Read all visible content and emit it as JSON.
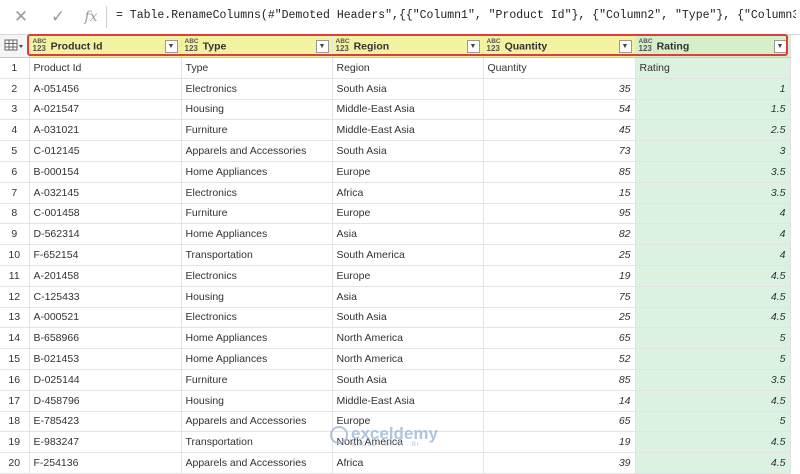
{
  "formula_bar": {
    "cancel_icon": "close-icon",
    "confirm_icon": "check-icon",
    "fx_label": "fx",
    "formula": "= Table.RenameColumns(#\"Demoted Headers\",{{\"Column1\", \"Product Id\"}, {\"Column2\", \"Type\"}, {\"Column3\","
  },
  "type_icon": {
    "top": "ABC",
    "bottom": "123"
  },
  "headers": [
    "Product Id",
    "Type",
    "Region",
    "Quantity",
    "Rating"
  ],
  "rows": [
    {
      "n": "1",
      "id": "Product Id",
      "type": "Type",
      "region": "Region",
      "qty": "Quantity",
      "rating": "Rating"
    },
    {
      "n": "2",
      "id": "A-051456",
      "type": "Electronics",
      "region": "South Asia",
      "qty": "35",
      "rating": "1"
    },
    {
      "n": "3",
      "id": "A-021547",
      "type": "Housing",
      "region": "Middle-East Asia",
      "qty": "54",
      "rating": "1.5"
    },
    {
      "n": "4",
      "id": "A-031021",
      "type": "Furniture",
      "region": "Middle-East Asia",
      "qty": "45",
      "rating": "2.5"
    },
    {
      "n": "5",
      "id": "C-012145",
      "type": "Apparels and Accessories",
      "region": "South Asia",
      "qty": "73",
      "rating": "3"
    },
    {
      "n": "6",
      "id": "B-000154",
      "type": "Home Appliances",
      "region": "Europe",
      "qty": "85",
      "rating": "3.5"
    },
    {
      "n": "7",
      "id": "A-032145",
      "type": "Electronics",
      "region": "Africa",
      "qty": "15",
      "rating": "3.5"
    },
    {
      "n": "8",
      "id": "C-001458",
      "type": "Furniture",
      "region": "Europe",
      "qty": "95",
      "rating": "4"
    },
    {
      "n": "9",
      "id": "D-562314",
      "type": "Home Appliances",
      "region": "Asia",
      "qty": "82",
      "rating": "4"
    },
    {
      "n": "10",
      "id": "F-652154",
      "type": "Transportation",
      "region": "South America",
      "qty": "25",
      "rating": "4"
    },
    {
      "n": "11",
      "id": "A-201458",
      "type": "Electronics",
      "region": "Europe",
      "qty": "19",
      "rating": "4.5"
    },
    {
      "n": "12",
      "id": "C-125433",
      "type": "Housing",
      "region": "Asia",
      "qty": "75",
      "rating": "4.5"
    },
    {
      "n": "13",
      "id": "A-000521",
      "type": "Electronics",
      "region": "South Asia",
      "qty": "25",
      "rating": "4.5"
    },
    {
      "n": "14",
      "id": "B-658966",
      "type": "Home Appliances",
      "region": "North America",
      "qty": "65",
      "rating": "5"
    },
    {
      "n": "15",
      "id": "B-021453",
      "type": "Home Appliances",
      "region": "North America",
      "qty": "52",
      "rating": "5"
    },
    {
      "n": "16",
      "id": "D-025144",
      "type": "Furniture",
      "region": "South Asia",
      "qty": "85",
      "rating": "3.5"
    },
    {
      "n": "17",
      "id": "D-458796",
      "type": "Housing",
      "region": "Middle-East Asia",
      "qty": "14",
      "rating": "4.5"
    },
    {
      "n": "18",
      "id": "E-785423",
      "type": "Apparels and Accessories",
      "region": "Europe",
      "qty": "65",
      "rating": "5"
    },
    {
      "n": "19",
      "id": "E-983247",
      "type": "Transportation",
      "region": "North America",
      "qty": "19",
      "rating": "4.5"
    },
    {
      "n": "20",
      "id": "F-254136",
      "type": "Apparels and Accessories",
      "region": "Africa",
      "qty": "39",
      "rating": "4.5"
    }
  ],
  "watermark": {
    "main": "exceldemy",
    "sub": "EXCEL · DATA · BI"
  },
  "colors": {
    "header_bg": "#f2f2a0",
    "rating_bg": "#dcf2e0",
    "highlight": "#e23b3b"
  }
}
